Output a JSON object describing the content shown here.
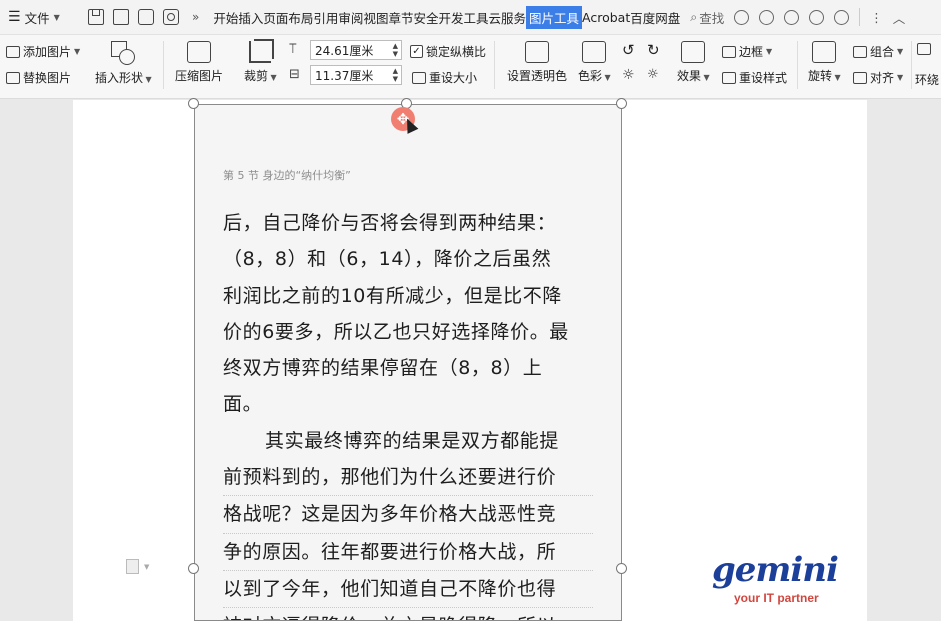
{
  "menubar": {
    "file_label": "文件",
    "tabs": [
      "开始",
      "插入",
      "页面",
      "布局",
      "引用",
      "审阅",
      "视图",
      "章节",
      "安全",
      "开发工具",
      "云服务",
      "图片工具",
      "Acrobat",
      "百度网盘"
    ],
    "active_tab": "图片工具",
    "search_label": "查找"
  },
  "ribbon": {
    "add_picture": "添加图片",
    "replace_picture": "替换图片",
    "insert_shape": "插入形状",
    "compress_picture": "压缩图片",
    "crop": "裁剪",
    "height_value": "24.61厘米",
    "width_value": "11.37厘米",
    "lock_ratio": "锁定纵横比",
    "reset_size": "重设大小",
    "set_transparent": "设置透明色",
    "color": "色彩",
    "effects": "效果",
    "border": "边框",
    "reset_style": "重设样式",
    "rotate": "旋转",
    "group": "组合",
    "align": "对齐",
    "wrap": "环绕"
  },
  "document": {
    "picture_header": "第 5 节  身边的“纳什均衡”",
    "lines": [
      "后，自己降价与否将会得到两种结果：",
      "（8，8）和（6，14），降价之后虽然",
      "利润比之前的10有所减少，但是比不降",
      "价的6要多，所以乙也只好选择降价。最",
      "终双方博弈的结果停留在（8，8）上",
      "面。",
      "其实最终博弈的结果是双方都能提",
      "前预料到的，那他们为什么还要进行价",
      "格战呢？这是因为多年价格大战恶性竞",
      "争的原因。往年都要进行价格大战，所",
      "以到了今年，他们知道自己不降价也得",
      "被对方逼得降价，总之是晚得降，所以"
    ]
  },
  "logo": {
    "word": "gemini",
    "tagline": "your IT partner"
  }
}
